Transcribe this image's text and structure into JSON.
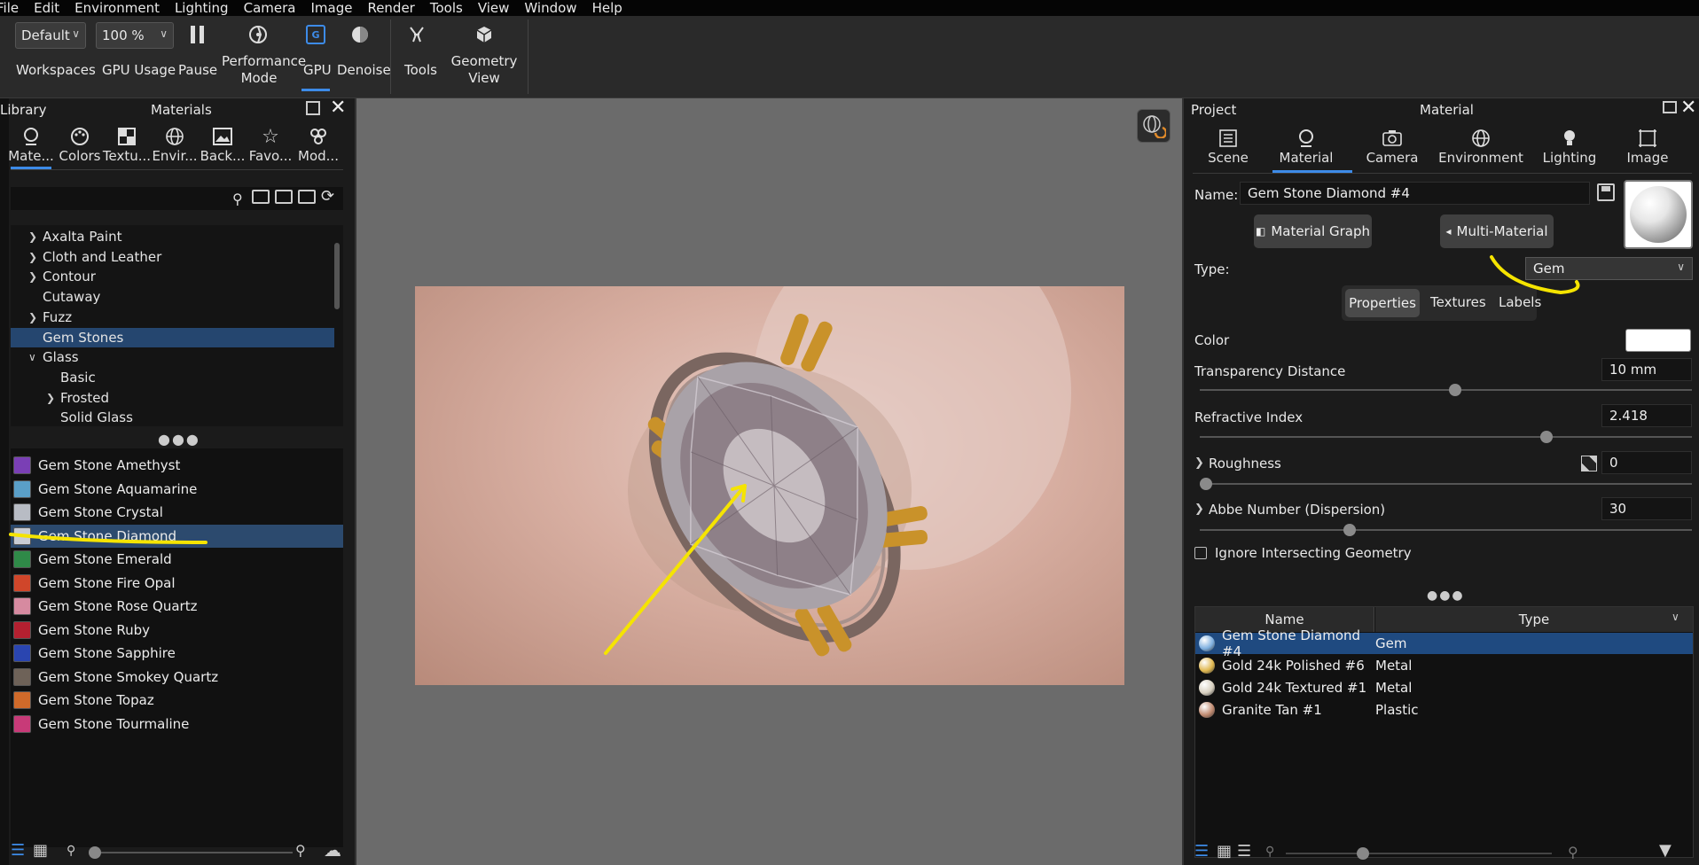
{
  "menu": [
    "File",
    "Edit",
    "Environment",
    "Lighting",
    "Camera",
    "Image",
    "Render",
    "Tools",
    "View",
    "Window",
    "Help"
  ],
  "ribbon": {
    "workspace_value": "Default",
    "workspaces_label": "Workspaces",
    "gpu_usage_value": "100 %",
    "gpu_usage_label": "GPU Usage",
    "pause_label": "Pause",
    "performance_mode_label_1": "Performance",
    "performance_mode_label_2": "Mode",
    "gpu_label": "GPU",
    "denoise_label": "Denoise",
    "tools_label": "Tools",
    "geometry_view_label_1": "Geometry",
    "geometry_view_label_2": "View"
  },
  "library": {
    "panel_label": "Library",
    "panel_title": "Materials",
    "tabs": [
      "Mate...",
      "Colors",
      "Textu...",
      "Envir...",
      "Back...",
      "Favo...",
      "Mod..."
    ],
    "tree": [
      {
        "label": "Axalta Paint",
        "expander": ">"
      },
      {
        "label": "Cloth and Leather",
        "expander": ">"
      },
      {
        "label": "Contour",
        "expander": ">"
      },
      {
        "label": "Cutaway",
        "expander": ""
      },
      {
        "label": "Fuzz",
        "expander": ">"
      },
      {
        "label": "Gem Stones",
        "expander": ""
      },
      {
        "label": "Glass",
        "expander": "v"
      },
      {
        "label": "Basic",
        "expander": ""
      },
      {
        "label": "Frosted",
        "expander": ">"
      },
      {
        "label": "Solid Glass",
        "expander": ""
      }
    ],
    "materials": [
      {
        "label": "Gem Stone Amethyst",
        "color": "#7a3fb5"
      },
      {
        "label": "Gem Stone Aquamarine",
        "color": "#5a9fc8"
      },
      {
        "label": "Gem Stone Crystal",
        "color": "#b8bcc4"
      },
      {
        "label": "Gem Stone Diamond",
        "color": "#c8ccd4"
      },
      {
        "label": "Gem Stone Emerald",
        "color": "#2f8a48"
      },
      {
        "label": "Gem Stone Fire Opal",
        "color": "#d0462a"
      },
      {
        "label": "Gem Stone Rose Quartz",
        "color": "#d68aa0"
      },
      {
        "label": "Gem Stone Ruby",
        "color": "#b42030"
      },
      {
        "label": "Gem Stone Sapphire",
        "color": "#2a45b0"
      },
      {
        "label": "Gem Stone Smokey Quartz",
        "color": "#6e6258"
      },
      {
        "label": "Gem Stone Topaz",
        "color": "#d06a2a"
      },
      {
        "label": "Gem Stone Tourmaline",
        "color": "#c83a78"
      }
    ]
  },
  "material_panel": {
    "project_label": "Project",
    "title": "Material",
    "tabs": [
      "Scene",
      "Material",
      "Camera",
      "Environment",
      "Lighting",
      "Image"
    ],
    "name_label": "Name:",
    "name_value": "Gem Stone Diamond #4",
    "material_graph_label": "Material Graph",
    "multi_material_label": "Multi-Material",
    "type_label": "Type:",
    "type_value": "Gem",
    "subtabs": [
      "Properties",
      "Textures",
      "Labels"
    ],
    "color_label": "Color",
    "color_value": "#ffffff",
    "transparency_label": "Transparency Distance",
    "transparency_value": "10 mm",
    "transparency_level": 0.52,
    "refractive_label": "Refractive Index",
    "refractive_value": "2.418",
    "refractive_level": 0.71,
    "roughness_label": "Roughness",
    "roughness_value": "0",
    "roughness_level": 0.0,
    "abbe_label": "Abbe Number (Dispersion)",
    "abbe_value": "30",
    "abbe_level": 0.3,
    "ignore_label": "Ignore Intersecting Geometry",
    "table_headers": [
      "Name",
      "Type"
    ],
    "table_rows": [
      {
        "name": "Gem Stone Diamond #4",
        "type": "Gem",
        "color": "#7fb0e0"
      },
      {
        "name": "Gold 24k Polished #6",
        "type": "Metal",
        "color": "#e0b850"
      },
      {
        "name": "Gold 24k Textured #1",
        "type": "Metal",
        "color": "#d8d0c0"
      },
      {
        "name": "Granite Tan #1",
        "type": "Plastic",
        "color": "#c08a70"
      }
    ]
  }
}
